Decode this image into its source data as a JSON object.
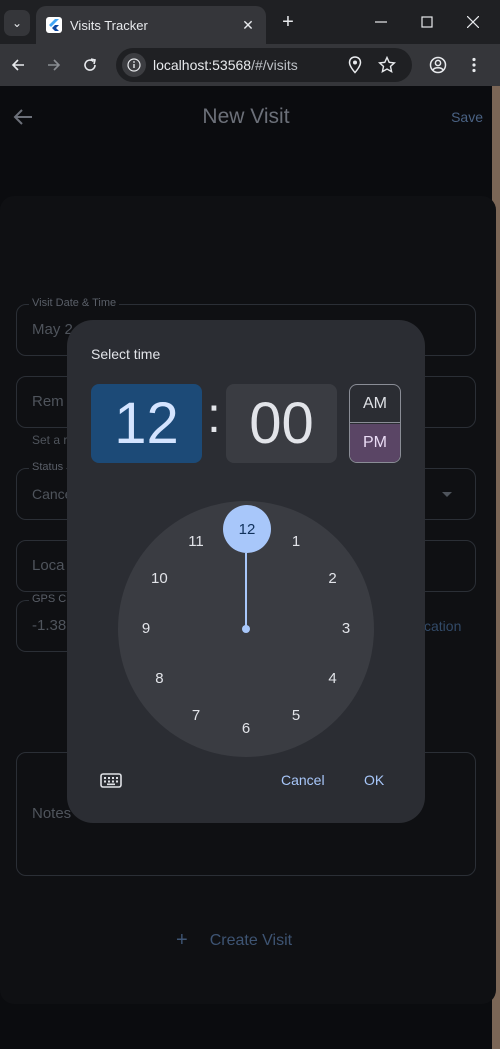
{
  "browser": {
    "tab_title": "Visits Tracker",
    "url_host": "localhost:53568",
    "url_path": "/#/visits"
  },
  "app": {
    "title": "New Visit",
    "save_label": "Save",
    "fields": {
      "visit_datetime_label": "Visit Date & Time",
      "visit_datetime_value": "May 2",
      "remarks_placeholder": "Rem",
      "remarks_helper": "Set a r",
      "status_label": "Status",
      "status_value": "Cance",
      "location_placeholder": "Loca",
      "gps_label": "GPS C",
      "gps_value": "-1.38",
      "location_link": "cation",
      "notes_placeholder": "Notes"
    },
    "create_visit_label": "Create Visit"
  },
  "time_picker": {
    "title": "Select time",
    "hour": "12",
    "colon": ":",
    "minute": "00",
    "am_label": "AM",
    "pm_label": "PM",
    "selected_period": "PM",
    "dial_numbers": [
      "12",
      "1",
      "2",
      "3",
      "4",
      "5",
      "6",
      "7",
      "8",
      "9",
      "10",
      "11"
    ],
    "selected_dial": "12",
    "cancel_label": "Cancel",
    "ok_label": "OK"
  },
  "colors": {
    "accent": "#a8c7fa",
    "hour_bg": "#1c4a77",
    "pm_bg": "#5a4565"
  }
}
